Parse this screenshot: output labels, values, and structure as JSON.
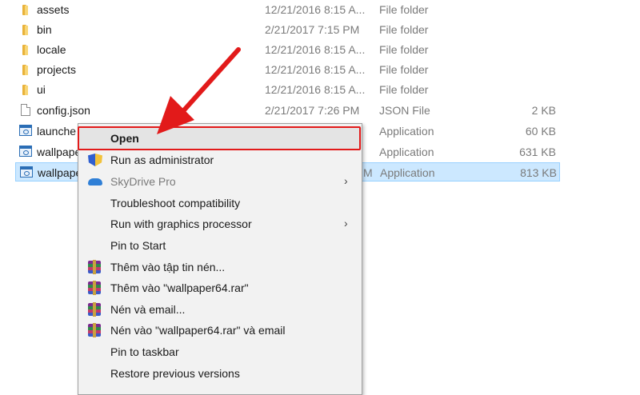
{
  "files": [
    {
      "name": "assets",
      "date": "12/21/2016 8:15 A...",
      "type": "File folder",
      "size": "",
      "icon": "folder-icon"
    },
    {
      "name": "bin",
      "date": "2/21/2017 7:15 PM",
      "type": "File folder",
      "size": "",
      "icon": "folder-icon"
    },
    {
      "name": "locale",
      "date": "12/21/2016 8:15 A...",
      "type": "File folder",
      "size": "",
      "icon": "folder-icon"
    },
    {
      "name": "projects",
      "date": "12/21/2016 8:15 A...",
      "type": "File folder",
      "size": "",
      "icon": "folder-icon"
    },
    {
      "name": "ui",
      "date": "12/21/2016 8:15 A...",
      "type": "File folder",
      "size": "",
      "icon": "folder-icon"
    },
    {
      "name": "config.json",
      "date": "2/21/2017 7:26 PM",
      "type": "JSON File",
      "size": "2 KB",
      "icon": "file-icon"
    },
    {
      "name": "launche",
      "date": "",
      "type": "Application",
      "size": "60 KB",
      "icon": "application-icon"
    },
    {
      "name": "wallpaper",
      "date": "",
      "type": "Application",
      "size": "631 KB",
      "icon": "application-icon"
    },
    {
      "name": "wallpaper",
      "date": "M",
      "type": "Application",
      "size": "813 KB",
      "icon": "application-icon",
      "selected": true
    }
  ],
  "context_menu": {
    "items": [
      {
        "label": "Open",
        "icon": "",
        "default": true
      },
      {
        "label": "Run as administrator",
        "icon": "uac-shield-icon"
      },
      {
        "label": "SkyDrive Pro",
        "icon": "skydrive-cloud-icon",
        "submenu": true,
        "disabled": true
      },
      {
        "label": "Troubleshoot compatibility",
        "icon": ""
      },
      {
        "label": "Run with graphics processor",
        "icon": "",
        "submenu": true
      },
      {
        "label": "Pin to Start",
        "icon": ""
      },
      {
        "label": "Thêm vào tập tin nén...",
        "icon": "winrar-icon"
      },
      {
        "label": "Thêm vào \"wallpaper64.rar\"",
        "icon": "winrar-icon"
      },
      {
        "label": "Nén và email...",
        "icon": "winrar-icon"
      },
      {
        "label": "Nén vào \"wallpaper64.rar\" và email",
        "icon": "winrar-icon"
      },
      {
        "label": "Pin to taskbar",
        "icon": ""
      },
      {
        "label": "Restore previous versions",
        "icon": ""
      }
    ],
    "submenu_glyph": "›"
  },
  "colors": {
    "selection": "#cce8ff",
    "highlight_box": "#e21a1a",
    "arrow": "#e21a1a",
    "menu_bg": "#f2f2f2"
  }
}
